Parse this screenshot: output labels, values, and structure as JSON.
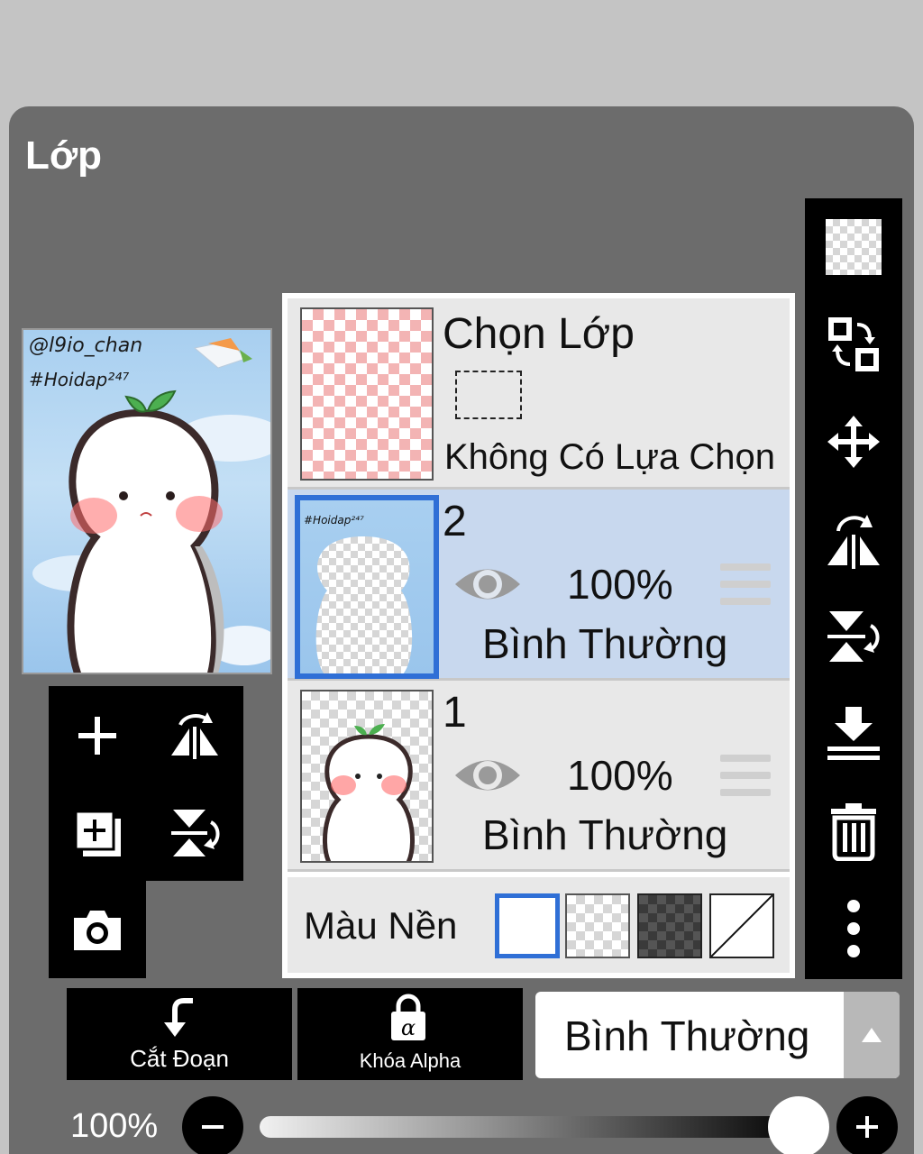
{
  "panel": {
    "title": "Lớp"
  },
  "preview": {
    "watermark_line1": "@l9io_chan",
    "watermark_line2": "#Hoidap²⁴⁷"
  },
  "layers": {
    "selection": {
      "title": "Chọn Lớp",
      "status": "Không Có Lựa Chọn"
    },
    "items": [
      {
        "number": "2",
        "opacity": "100%",
        "mode": "Bình Thường",
        "selected": true
      },
      {
        "number": "1",
        "opacity": "100%",
        "mode": "Bình Thường",
        "selected": false
      }
    ],
    "background": {
      "label": "Màu Nền",
      "options": [
        "white",
        "checker",
        "dark-checker",
        "none"
      ],
      "selected": "white"
    }
  },
  "bottom": {
    "clip_label": "Cắt Đoạn",
    "alpha_lock_label": "Khóa Alpha",
    "blend_mode": "Bình Thường"
  },
  "opacity": {
    "label": "100%",
    "value": 1.0
  },
  "colors": {
    "accent": "#2f6fd6",
    "panel": "#6c6c6c",
    "selected_row": "#c8d8ee"
  }
}
